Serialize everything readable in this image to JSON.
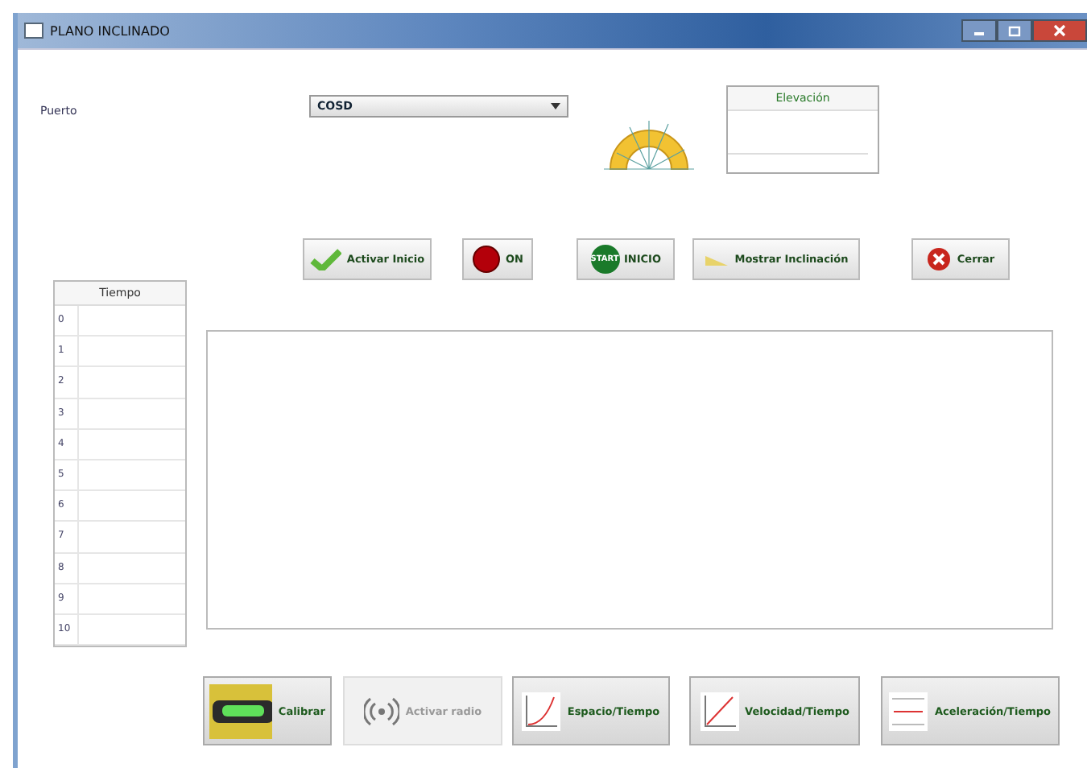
{
  "window": {
    "title": "PLANO INCLINADO"
  },
  "port": {
    "label": "Puerto",
    "value": "COSD"
  },
  "elevation": {
    "header": "Elevación"
  },
  "top_buttons": [
    {
      "label": "Activar Inicio",
      "kind": "check"
    },
    {
      "label": "ON",
      "kind": "led"
    },
    {
      "label": "INICIO",
      "kind": "start",
      "badge": "START"
    },
    {
      "label": "Mostrar Inclinación",
      "kind": "incline"
    },
    {
      "label": "Cerrar",
      "kind": "close"
    }
  ],
  "time_table": {
    "header": "Tiempo",
    "rows": [
      "0",
      "1",
      "2",
      "3",
      "4",
      "5",
      "6",
      "7",
      "8",
      "9",
      "10"
    ]
  },
  "bottom_buttons": [
    {
      "label": "Calibrar",
      "kind": "level",
      "disabled": false
    },
    {
      "label": "Activar radio",
      "kind": "radio",
      "disabled": true
    },
    {
      "label": "Espacio/Tiempo",
      "kind": "curve",
      "disabled": false
    },
    {
      "label": "Velocidad/Tiempo",
      "kind": "linear",
      "disabled": false
    },
    {
      "label": "Aceleración/Tiempo",
      "kind": "flat",
      "disabled": false
    }
  ]
}
